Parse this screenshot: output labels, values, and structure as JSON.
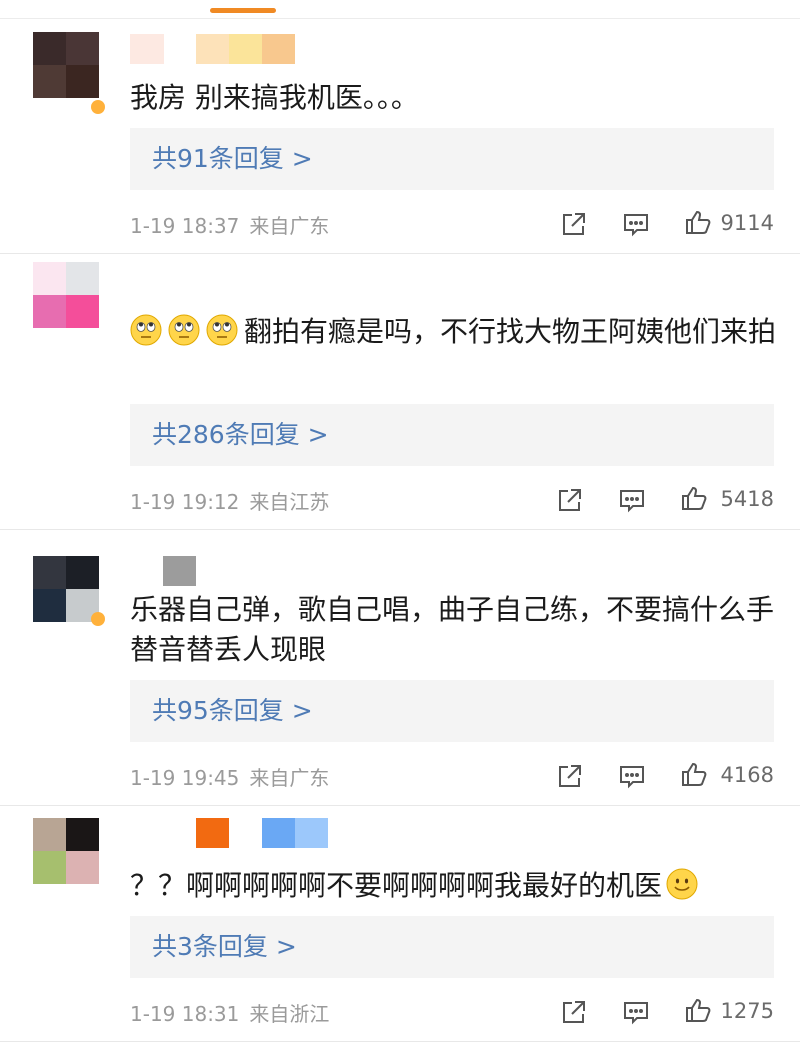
{
  "comments": [
    {
      "text": "我房 别来搞我机医。。。",
      "replies": "共91条回复 >",
      "time": "1-19 18:37",
      "region": "来自广东",
      "likes": "9114"
    },
    {
      "text": "翻拍有瘾是吗，不行找大物王阿姨他们来拍",
      "replies": "共286条回复 >",
      "time": "1-19 19:12",
      "region": "来自江苏",
      "likes": "5418"
    },
    {
      "text": "乐器自己弹，歌自己唱，曲子自己练，不要搞什么手替音替丢人现眼",
      "replies": "共95条回复 >",
      "time": "1-19 19:45",
      "region": "来自广东",
      "likes": "4168"
    },
    {
      "text": "？？啊啊啊啊啊不要啊啊啊啊我最好的机医",
      "replies": "共3条回复 >",
      "time": "1-19 18:31",
      "region": "来自浙江",
      "likes": "1275"
    }
  ],
  "icons": {
    "share": "share-icon",
    "comment": "comment-icon",
    "like": "thumbs-up-icon",
    "rolling_eyes": "rolling-eyes-emoji",
    "smile": "smile-emoji"
  },
  "colors": {
    "accent": "#f08a24",
    "link": "#4f7bb5",
    "meta": "#9a9a9a",
    "reply_bg": "#f4f4f4"
  }
}
